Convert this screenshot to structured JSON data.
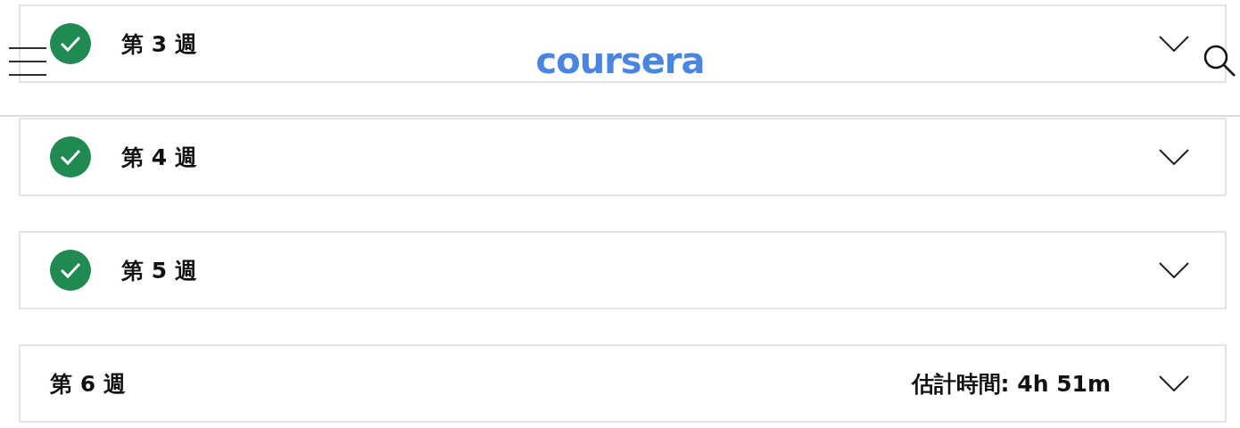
{
  "header": {
    "logo": "coursera"
  },
  "weeks": [
    {
      "title": "第 3 週",
      "completed": true,
      "expanded": false
    },
    {
      "title": "第 4 週",
      "completed": true,
      "expanded": false
    },
    {
      "title": "第 5 週",
      "completed": true,
      "expanded": false
    },
    {
      "title": "第 6 週",
      "completed": false,
      "expanded": false,
      "estimate": "估計時間: 4h 51m"
    }
  ]
}
